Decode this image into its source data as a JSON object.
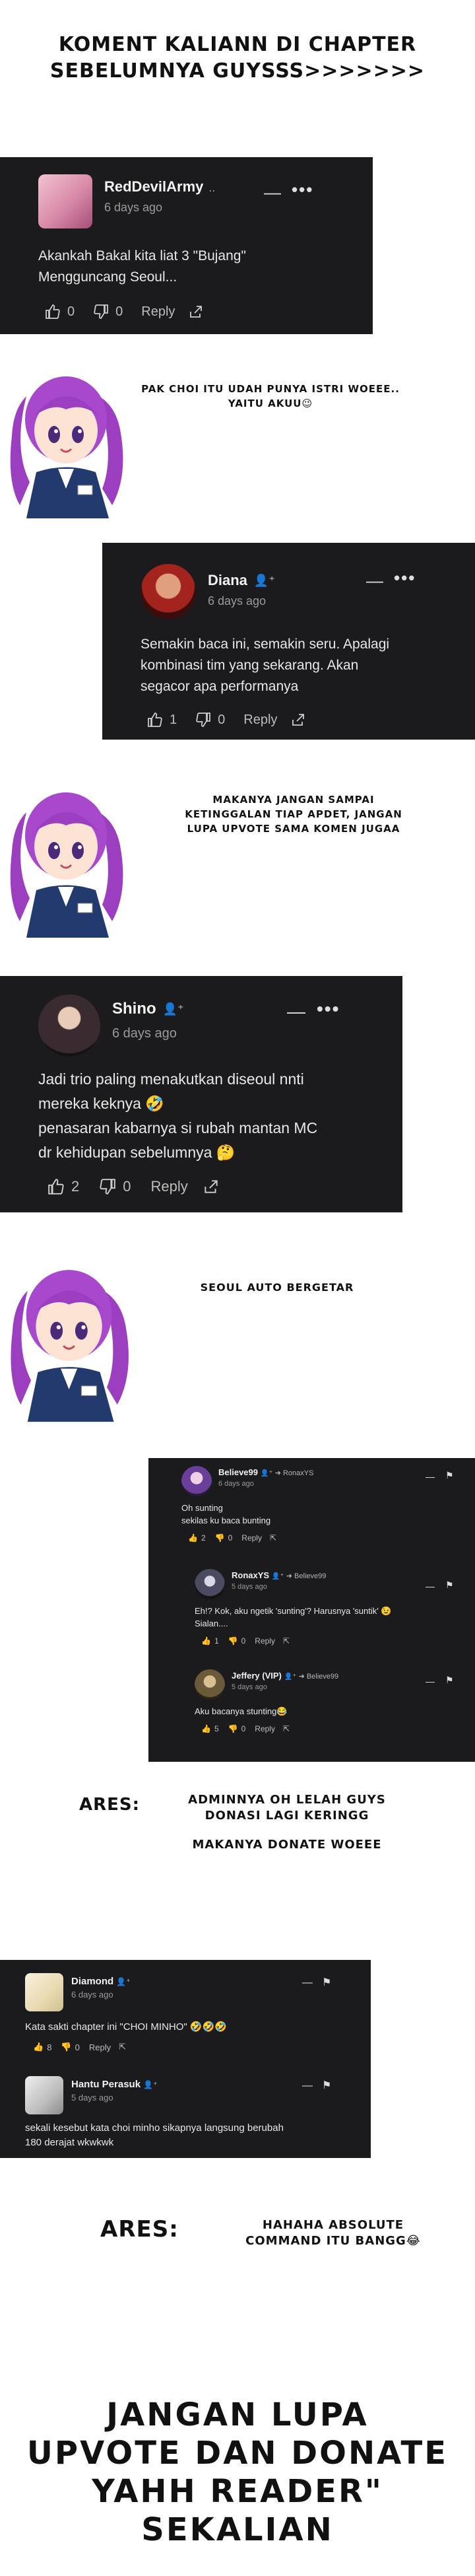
{
  "header": {
    "line1": "KOMENT KALIANN DI CHAPTER",
    "line2": "SEBELUMNYA GUYSSS>>>>>>>"
  },
  "comments": {
    "c1": {
      "user": "RedDevilArmy",
      "suffix": "..",
      "time": "6 days ago",
      "text1": "Akankah Bakal kita liat 3 \"Bujang\"",
      "text2": "Mengguncang Seoul...",
      "likes": "0",
      "dislikes": "0",
      "reply": "Reply"
    },
    "c2": {
      "user": "Diana",
      "time": "6 days ago",
      "text1": "Semakin baca ini, semakin seru. Apalagi",
      "text2": "kombinasi tim yang sekarang. Akan",
      "text3": "segacor apa performanya",
      "likes": "1",
      "dislikes": "0",
      "reply": "Reply"
    },
    "c3": {
      "user": "Shino",
      "time": "6 days ago",
      "text1": "Jadi trio paling menakutkan diseoul nnti",
      "text2": "mereka keknya 🤣",
      "text3": "penasaran kabarnya si rubah mantan MC",
      "text4": "dr kehidupan sebelumnya 🤔",
      "likes": "2",
      "dislikes": "0",
      "reply": "Reply"
    },
    "c4": {
      "user": "Believe99",
      "reply_to": "RonaxYS",
      "time": "6 days ago",
      "text1": "Oh sunting",
      "text2": "sekilas ku baca bunting",
      "likes": "2",
      "dislikes": "0",
      "reply": "Reply"
    },
    "c5": {
      "user": "RonaxYS",
      "reply_to": "Believe99",
      "time": "5 days ago",
      "text1": "Eh!? Kok, aku ngetik 'sunting'? Harusnya 'suntik' 😉",
      "text2": "Sialan....",
      "likes": "1",
      "dislikes": "0",
      "reply": "Reply"
    },
    "c6": {
      "user": "Jeffery (VIP)",
      "reply_to": "Believe99",
      "time": "5 days ago",
      "text1": "Aku bacanya stunting😂",
      "likes": "5",
      "dislikes": "0",
      "reply": "Reply"
    },
    "c7": {
      "user": "Diamond",
      "time": "6 days ago",
      "text1": "Kata sakti chapter ini \"CHOI MINHO\" 🤣🤣🤣",
      "likes": "8",
      "dislikes": "0",
      "reply": "Reply"
    },
    "c8": {
      "user": "Hantu Perasuk",
      "time": "5 days ago",
      "text1": "sekali kesebut kata choi minho sikapnya langsung berubah",
      "text2": "180 derajat wkwkwk"
    }
  },
  "speech": {
    "s1": "PAK CHOI ITU UDAH PUNYA ISTRI WOEEE.. YAITU AKUU😉",
    "s2a": "MAKANYA JANGAN SAMPAI",
    "s2b": "KETINGGALAN TIAP APDET, JANGAN",
    "s2c": "LUPA UPVOTE SAMA KOMEN JUGAA",
    "s3": "SEOUL AUTO BERGETAR"
  },
  "ares1": {
    "label": "ARES:",
    "l1": "ADMINNYA OH LELAH GUYS",
    "l2": "DONASI LAGI KERINGG",
    "l3": "MAKANYA DONATE WOEEE"
  },
  "ares2": {
    "label": "ARES:",
    "l1": "HAHAHA ABSOLUTE",
    "l2": "COMMAND ITU BANGG😂"
  },
  "footer": {
    "l1": "JANGAN LUPA",
    "l2": "UPVOTE DAN DONATE",
    "l3": "YAHH READER\"",
    "l4": "SEKALIAN"
  },
  "icons": {
    "like": "thumb-up-icon",
    "dislike": "thumb-down-icon",
    "share": "share-icon",
    "follow": "person-add-icon",
    "menu": "more-icon",
    "collapse": "minus-icon",
    "flag": "flag-icon"
  },
  "colors": {
    "card_bg": "#1b1b1d",
    "hair": "#9b3fc0",
    "suit": "#233a6e"
  }
}
